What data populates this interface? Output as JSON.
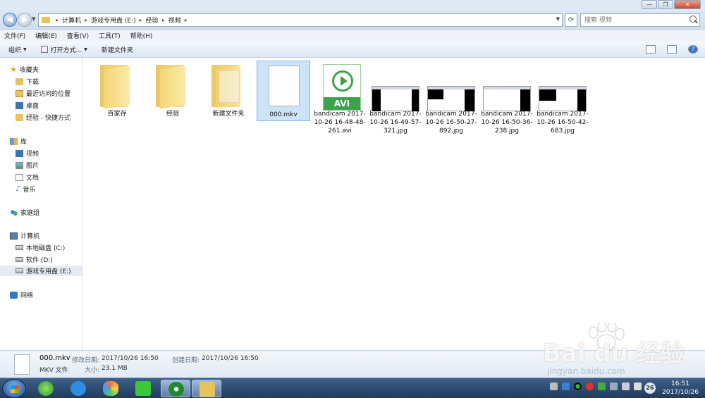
{
  "window": {
    "buttons": [
      "—",
      "❐",
      "✕"
    ]
  },
  "address": {
    "crumbs": [
      "计算机",
      "游戏专用盘 (E:)",
      "经验",
      "视频"
    ],
    "search_placeholder": "搜索 视频"
  },
  "menu": [
    "文件(F)",
    "编辑(E)",
    "查看(V)",
    "工具(T)",
    "帮助(H)"
  ],
  "toolbar": {
    "organize": "组织",
    "open_with": "打开方式...",
    "new_folder": "新建文件夹"
  },
  "sidebar": {
    "favorites": "收藏夹",
    "downloads": "下载",
    "recent": "最近访问的位置",
    "desktop": "桌面",
    "jingyan_shortcut": "经验 - 快捷方式",
    "libraries": "库",
    "videos": "视频",
    "pictures": "图片",
    "documents": "文档",
    "music": "音乐",
    "homegroup": "家庭组",
    "computer": "计算机",
    "drive_c": "本地磁盘 (C:)",
    "drive_d": "软件 (D:)",
    "drive_e": "游戏专用盘 (E:)",
    "network": "网络"
  },
  "files": [
    {
      "name": "百家存",
      "type": "folder"
    },
    {
      "name": "经验",
      "type": "folder"
    },
    {
      "name": "新建文件夹",
      "type": "folder-doc"
    },
    {
      "name": "000.mkv",
      "type": "mkv",
      "selected": true
    },
    {
      "name": "bandicam 2017-10-26 16-48-48-261.avi",
      "type": "avi",
      "badge": "AVI"
    },
    {
      "name": "bandicam 2017-10-26 16-49-57-321.jpg",
      "type": "jpg"
    },
    {
      "name": "bandicam 2017-10-26 16-50-27-892.jpg",
      "type": "jpg"
    },
    {
      "name": "bandicam 2017-10-26 16-50-36-238.jpg",
      "type": "jpg"
    },
    {
      "name": "bandicam 2017-10-26 16-50-42-683.jpg",
      "type": "jpg"
    }
  ],
  "details": {
    "name": "000.mkv",
    "type": "MKV 文件",
    "modified_label": "修改日期:",
    "modified": "2017/10/26 16:50",
    "created_label": "创建日期:",
    "created": "2017/10/26 16:50",
    "size_label": "大小:",
    "size": "23.1 MB"
  },
  "taskbar": {
    "badge": "26",
    "time": "16:51",
    "date": "2017/10/26"
  },
  "watermark": {
    "brand": "Bai  du 经验",
    "url": "jingyan.baidu.com"
  },
  "colors": {
    "avi_green": "#3ba34a",
    "selection": "#cde3f8",
    "folder": "#e7c45a"
  }
}
